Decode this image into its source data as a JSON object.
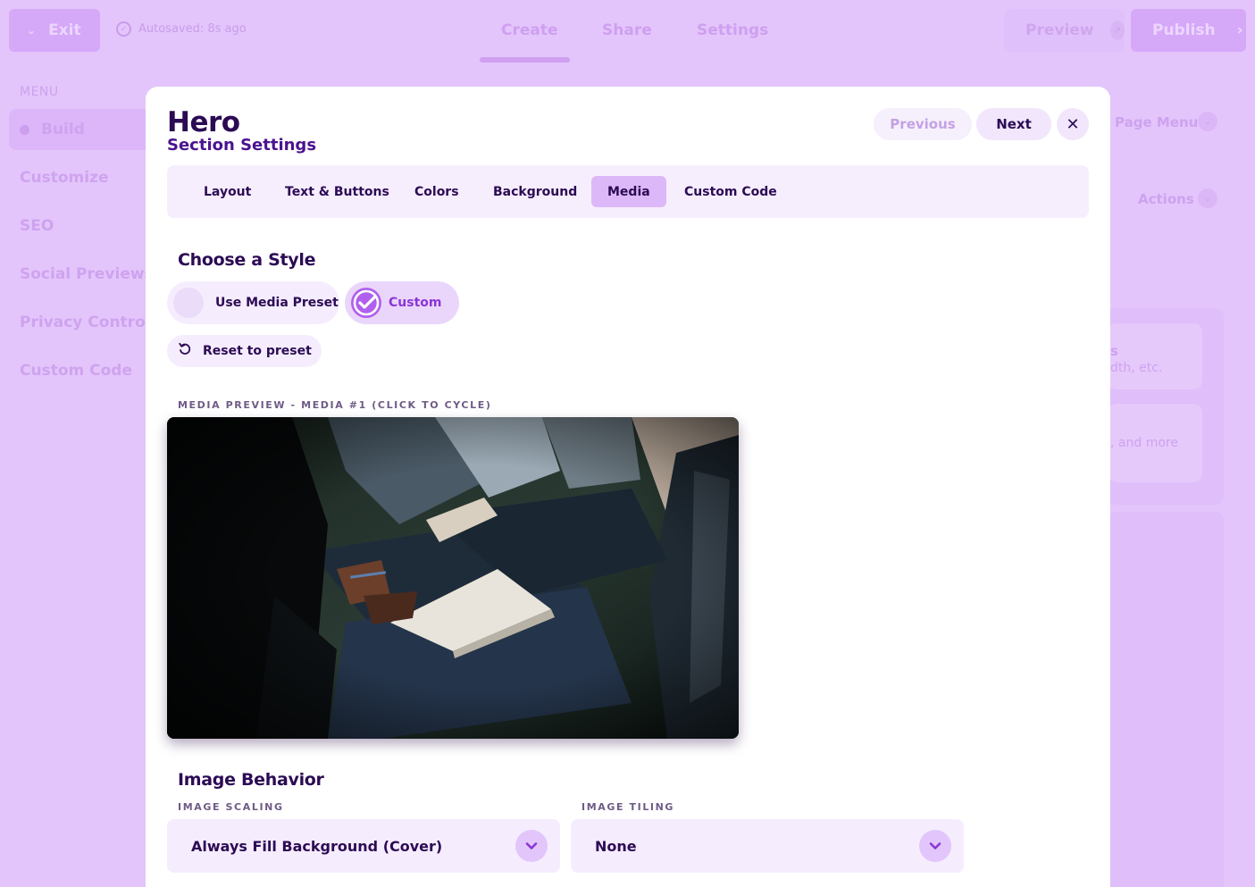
{
  "topbar": {
    "exit_label": "Exit",
    "autosave": "Autosaved: 8s ago",
    "tabs": [
      "Create",
      "Share",
      "Settings"
    ],
    "preview_label": "Preview",
    "publish_label": "Publish"
  },
  "sidebar": {
    "heading": "MENU",
    "items": [
      "Build",
      "Customize",
      "SEO",
      "Social Previews",
      "Privacy Controls",
      "Custom Code"
    ]
  },
  "right_panel": {
    "page_menu": "Page Menu",
    "actions": "Actions",
    "card1_title_fragment": "s",
    "card1_sub_fragment": "dth, etc.",
    "card2_sub_fragment": ", and more"
  },
  "modal": {
    "title": "Hero",
    "subtitle": "Section Settings",
    "previous_label": "Previous",
    "next_label": "Next",
    "tabs": [
      "Layout",
      "Text & Buttons",
      "Colors",
      "Background",
      "Media",
      "Custom Code"
    ],
    "active_tab": "Media",
    "choose_style_heading": "Choose a Style",
    "style_options": [
      "Use Media Preset",
      "Custom"
    ],
    "selected_style": "Custom",
    "reset_label": "Reset to preset",
    "media_preview_label": "MEDIA PREVIEW - MEDIA #1 (CLICK TO CYCLE)",
    "image_behavior_heading": "Image Behavior",
    "image_scaling_label": "IMAGE SCALING",
    "image_scaling_value": "Always Fill Background (Cover)",
    "image_tiling_label": "IMAGE TILING",
    "image_tiling_value": "None"
  },
  "colors": {
    "accent": "#8b35d6",
    "dark_text": "#2c0b54",
    "overlay_bg": "#e3c5fb"
  }
}
